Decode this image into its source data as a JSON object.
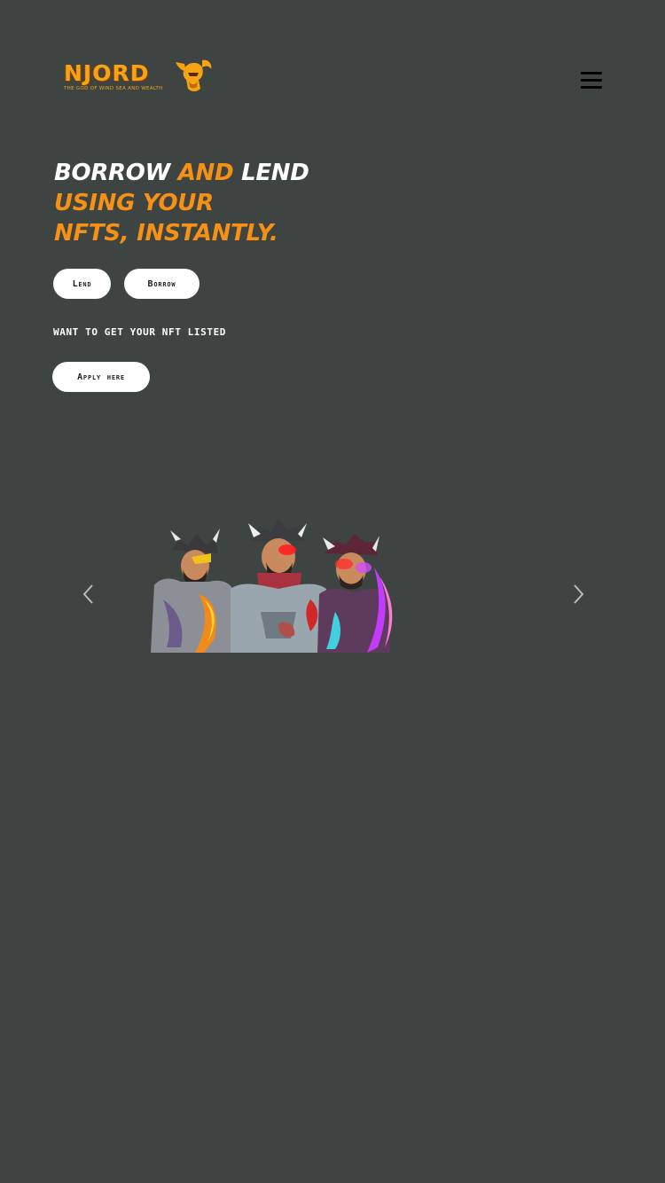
{
  "header": {
    "logo_text": "NJORD",
    "logo_tagline": "THE GOD OF WIND SEA AND WEALTH",
    "menu_icon": "hamburger-menu-icon"
  },
  "hero": {
    "headline_line1_part1": "BORROW",
    "headline_line1_part2": "AND",
    "headline_line1_part3": "LEND",
    "headline_line2": "USING YOUR",
    "headline_line3": "NFTS, INSTANTLY.",
    "lend_label": "Lend",
    "borrow_label": "Borrow",
    "listing_prompt": "WANT TO GET YOUR NFT LISTED",
    "apply_label": "Apply here"
  },
  "carousel": {
    "prev_icon": "chevron-left-icon",
    "next_icon": "chevron-right-icon",
    "slide_image": "three-armored-warriors-nft-artwork"
  },
  "colors": {
    "background": "#3e4442",
    "accent": "#f79116",
    "button_bg": "#ffffff"
  }
}
